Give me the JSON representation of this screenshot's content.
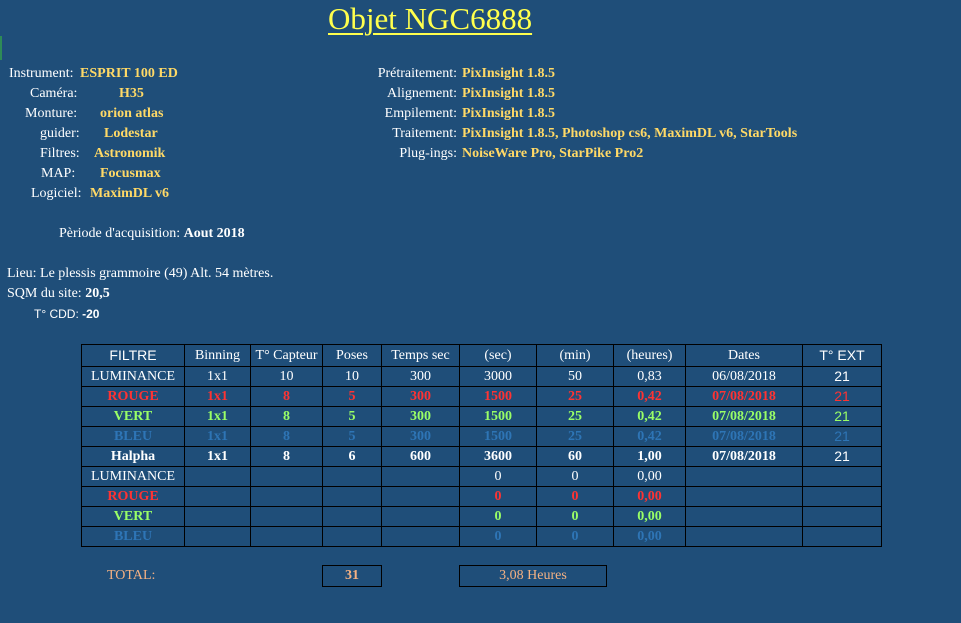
{
  "title": "Objet NGC6888",
  "equipment": [
    {
      "label": "Instrument:",
      "value": "ESPRIT 100 ED"
    },
    {
      "label": "Caméra:",
      "value": "H35"
    },
    {
      "label": "Monture:",
      "value": "orion atlas"
    },
    {
      "label": "guider:",
      "value": "Lodestar"
    },
    {
      "label": "Filtres:",
      "value": "Astronomik"
    },
    {
      "label": "MAP:",
      "value": "Focusmax"
    },
    {
      "label": "Logiciel:",
      "value": "MaximDL v6"
    }
  ],
  "processing": [
    {
      "label": "Prétraitement:",
      "value": "PixInsight 1.8.5"
    },
    {
      "label": "Alignement:",
      "value": "PixInsight 1.8.5"
    },
    {
      "label": "Empilement:",
      "value": "PixInsight 1.8.5"
    },
    {
      "label": "Traitement:",
      "value": "PixInsight 1.8.5, Photoshop cs6, MaximDL v6, StarTools"
    },
    {
      "label": "Plug-ings:",
      "value": "NoiseWare Pro, StarPike Pro2"
    }
  ],
  "acquisition": {
    "label": "Pèriode d'acquisition:",
    "value": "Aout 2018"
  },
  "site": {
    "lieu": "Lieu: Le plessis grammoire (49) Alt. 54 mètres.",
    "sqm_label": "SQM du site:",
    "sqm_value": "20,5",
    "cdd_label": "T° CDD:",
    "cdd_value": "-20"
  },
  "table": {
    "headers": [
      "FILTRE",
      "Binning",
      "T° Capteur",
      "Poses",
      "Temps sec",
      "(sec)",
      "(min)",
      "(heures)",
      "Dates",
      "T° EXT"
    ],
    "rows": [
      {
        "cells": [
          "LUMINANCE",
          "1x1",
          "10",
          "10",
          "300",
          "3000",
          "50",
          "0,83",
          "06/08/2018",
          "21"
        ]
      },
      {
        "cells": [
          "ROUGE",
          "1x1",
          "8",
          "5",
          "300",
          "1500",
          "25",
          "0,42",
          "07/08/2018",
          "21"
        ]
      },
      {
        "cells": [
          "VERT",
          "1x1",
          "8",
          "5",
          "300",
          "1500",
          "25",
          "0,42",
          "07/08/2018",
          "21"
        ]
      },
      {
        "cells": [
          "BLEU",
          "1x1",
          "8",
          "5",
          "300",
          "1500",
          "25",
          "0,42",
          "07/08/2018",
          "21"
        ]
      },
      {
        "cells": [
          "Halpha",
          "1x1",
          "8",
          "6",
          "600",
          "3600",
          "60",
          "1,00",
          "07/08/2018",
          "21"
        ]
      },
      {
        "cells": [
          "LUMINANCE",
          "",
          "",
          "",
          "",
          "0",
          "0",
          "0,00",
          "",
          ""
        ]
      },
      {
        "cells": [
          "ROUGE",
          "",
          "",
          "",
          "",
          "0",
          "0",
          "0,00",
          "",
          ""
        ]
      },
      {
        "cells": [
          "VERT",
          "",
          "",
          "",
          "",
          "0",
          "0",
          "0,00",
          "",
          ""
        ]
      },
      {
        "cells": [
          "BLEU",
          "",
          "",
          "",
          "",
          "0",
          "0",
          "0,00",
          "",
          ""
        ]
      }
    ]
  },
  "totals": {
    "label": "TOTAL:",
    "poses": "31",
    "hours": "3,08 Heures"
  },
  "colors": {
    "background": "#1f4e79",
    "title": "#ffff4d",
    "value": "#ffd966",
    "red": "#ff3333",
    "green": "#99ff66",
    "blue": "#2e75b6",
    "total": "#f4b183"
  }
}
